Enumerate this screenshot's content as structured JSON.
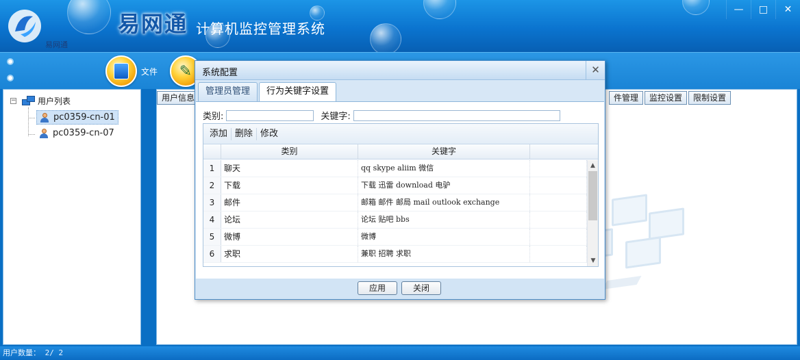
{
  "header": {
    "brand": "易网通",
    "brand_sub": "易网通",
    "app_title": "计算机监控管理系统",
    "window_buttons": [
      "—",
      "□",
      "✕"
    ]
  },
  "toolbar": {
    "items": [
      {
        "label": "文件",
        "icon": "folder-icon"
      },
      {
        "label": "",
        "icon": "tools-icon"
      }
    ]
  },
  "tree": {
    "root_label": "用户列表",
    "toggle": "−",
    "users": [
      "pc0359-cn-01",
      "pc0359-cn-07"
    ],
    "selected_index": 0
  },
  "content_tabs": {
    "left": [
      "用户信息"
    ],
    "right": [
      "件管理",
      "监控设置",
      "限制设置"
    ]
  },
  "status": {
    "label": "用户数量：",
    "value": "2/ 2"
  },
  "dialog": {
    "title": "系统配置",
    "close": "✕",
    "tabs": [
      "管理员管理",
      "行为关键字设置"
    ],
    "active_tab": 1,
    "filter": {
      "category_label": "类别:",
      "category_value": "",
      "keyword_label": "关键字:",
      "keyword_value": ""
    },
    "grid_toolbar": [
      "添加",
      "删除",
      "修改"
    ],
    "columns": [
      "类别",
      "关键字"
    ],
    "rows": [
      {
        "num": "1",
        "category": "聊天",
        "keywords": "qq skype aliim 微信"
      },
      {
        "num": "2",
        "category": "下载",
        "keywords": "下载 迅雷 download 电驴"
      },
      {
        "num": "3",
        "category": "邮件",
        "keywords": "邮箱 邮件 邮局 mail outlook exchange"
      },
      {
        "num": "4",
        "category": "论坛",
        "keywords": "论坛 贴吧 bbs"
      },
      {
        "num": "5",
        "category": "微博",
        "keywords": "微博"
      },
      {
        "num": "6",
        "category": "求职",
        "keywords": "兼职 招聘 求职"
      }
    ],
    "scroll_up": "▲",
    "scroll_down": "▼",
    "buttons": {
      "apply": "应用",
      "close": "关闭"
    }
  },
  "colors": {
    "header_blue": "#0b74cf",
    "dialog_bg": "#d7e7f6",
    "toolbar_orange": "#ffd23a"
  }
}
